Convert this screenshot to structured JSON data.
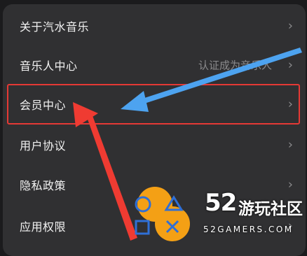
{
  "settings": {
    "items": [
      {
        "label": "关于汽水音乐",
        "sub": ""
      },
      {
        "label": "音乐人中心",
        "sub": "认证成为音乐人"
      },
      {
        "label": "会员中心",
        "sub": ""
      },
      {
        "label": "用户协议",
        "sub": ""
      },
      {
        "label": "隐私政策",
        "sub": ""
      },
      {
        "label": "应用权限",
        "sub": ""
      }
    ],
    "chevron": "›"
  },
  "watermark": {
    "number": "52",
    "title": "游玩社区",
    "site": "52GAMERS.COM"
  },
  "colors": {
    "highlight": "#e53935",
    "red_arrow": "#ef3b32",
    "blue_arrow": "#4da3f0",
    "logo_orange": "#f4a015",
    "logo_blue": "#2f6fd6"
  },
  "icons": [
    "chevron-right-icon",
    "gamers-logo-icon"
  ]
}
